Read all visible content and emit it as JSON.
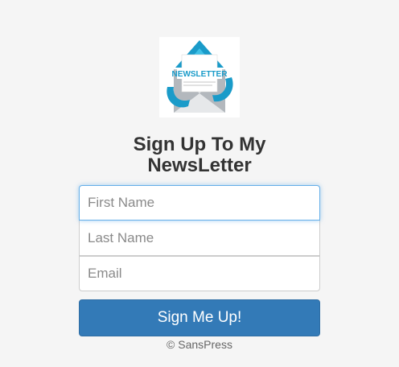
{
  "logo": {
    "icon": "newsletter-envelope-icon",
    "banner_text": "NEWSLETTER"
  },
  "title": {
    "line1": "Sign Up To My",
    "line2": "NewsLetter"
  },
  "form": {
    "first_name_placeholder": "First Name",
    "last_name_placeholder": "Last Name",
    "email_placeholder": "Email",
    "submit_label": "Sign Me Up!"
  },
  "footer": {
    "copyright": "© SansPress"
  },
  "colors": {
    "background": "#f5f5f5",
    "button": "#337ab7",
    "focus_border": "#66afe9",
    "banner_blue": "#1a9bc9"
  }
}
